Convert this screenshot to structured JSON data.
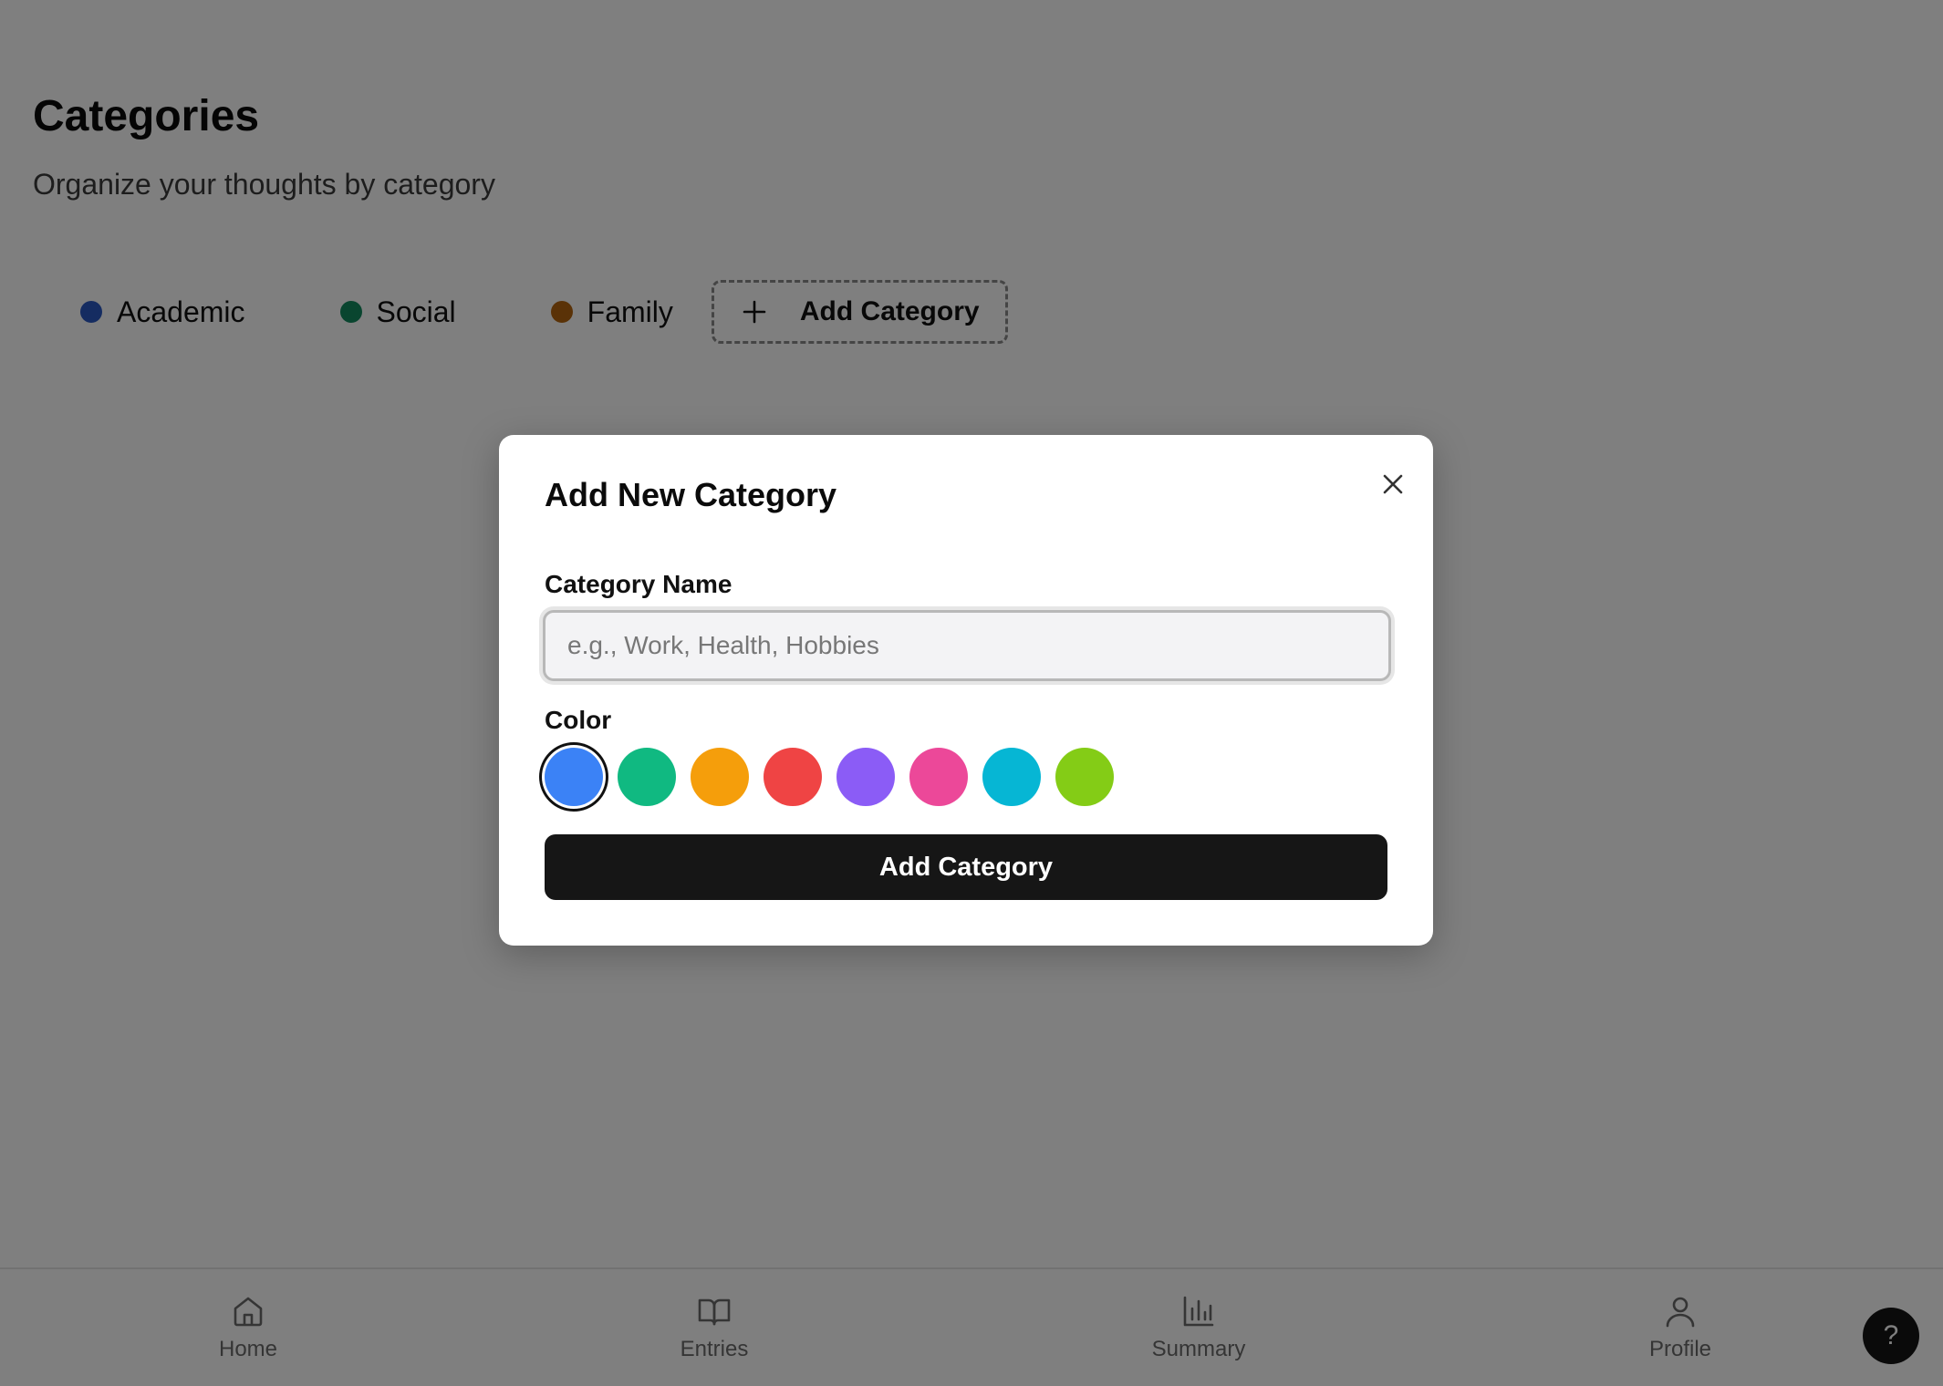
{
  "page": {
    "title": "Categories",
    "subtitle": "Organize your thoughts by category"
  },
  "categories": [
    {
      "label": "Academic",
      "color": "#2b59c3"
    },
    {
      "label": "Social",
      "color": "#128a5f"
    },
    {
      "label": "Family",
      "color": "#b5650e"
    }
  ],
  "add_category_chip": {
    "label": "Add Category",
    "icon": "plus-icon"
  },
  "modal": {
    "title": "Add New Category",
    "close_icon": "close-icon",
    "name_label": "Category Name",
    "name_value": "",
    "name_placeholder": "e.g., Work, Health, Hobbies",
    "color_label": "Color",
    "colors": [
      {
        "name": "blue",
        "hex": "#3b82f6",
        "selected": true
      },
      {
        "name": "green",
        "hex": "#10b981",
        "selected": false
      },
      {
        "name": "amber",
        "hex": "#f59e0b",
        "selected": false
      },
      {
        "name": "red",
        "hex": "#ef4444",
        "selected": false
      },
      {
        "name": "purple",
        "hex": "#8b5cf6",
        "selected": false
      },
      {
        "name": "pink",
        "hex": "#ec4899",
        "selected": false
      },
      {
        "name": "cyan",
        "hex": "#06b6d4",
        "selected": false
      },
      {
        "name": "lime",
        "hex": "#84cc16",
        "selected": false
      }
    ],
    "submit_label": "Add Category"
  },
  "bottom_nav": {
    "items": [
      {
        "label": "Home",
        "icon": "home-icon"
      },
      {
        "label": "Entries",
        "icon": "book-icon"
      },
      {
        "label": "Summary",
        "icon": "bar-chart-icon"
      },
      {
        "label": "Profile",
        "icon": "user-icon"
      }
    ]
  },
  "help_button": {
    "label": "?"
  }
}
